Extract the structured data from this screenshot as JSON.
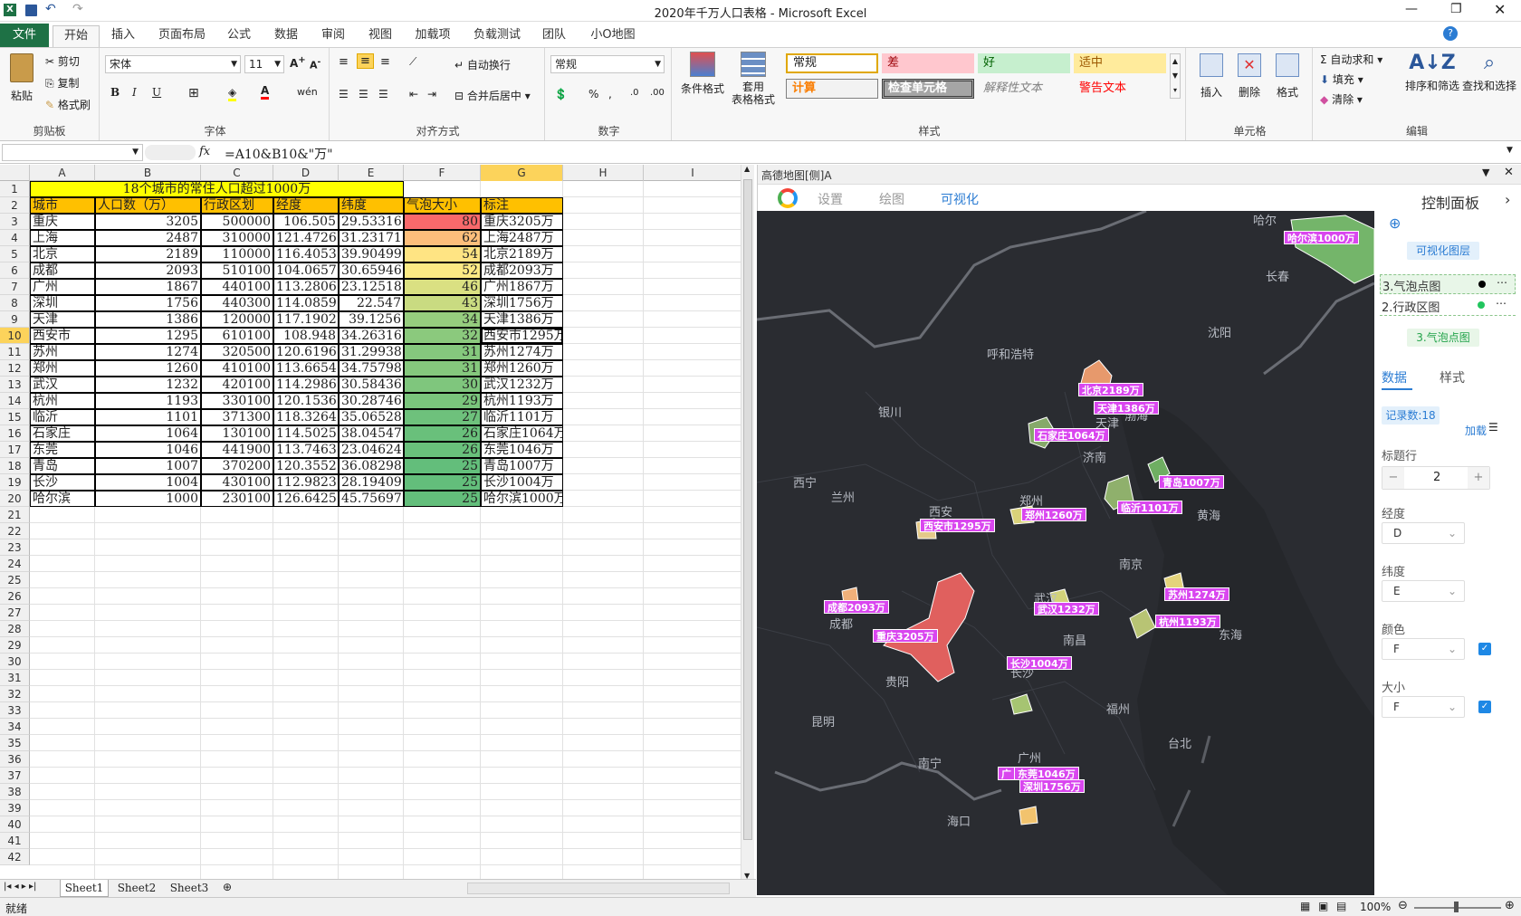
{
  "window": {
    "title": "2020年千万人口表格 - Microsoft Excel"
  },
  "tabs": [
    "文件",
    "开始",
    "插入",
    "页面布局",
    "公式",
    "数据",
    "审阅",
    "视图",
    "加载项",
    "负载测试",
    "团队",
    "小O地图"
  ],
  "ribbon": {
    "clipboard": {
      "paste": "粘贴",
      "cut": "剪切",
      "copy": "复制",
      "format_painter": "格式刷",
      "label": "剪贴板"
    },
    "font": {
      "name": "宋体",
      "size": "11",
      "label": "字体"
    },
    "align": {
      "wrap": "自动换行",
      "merge": "合并后居中",
      "label": "对齐方式"
    },
    "number": {
      "format": "常规",
      "label": "数字"
    },
    "styles": {
      "cond": "条件格式",
      "table": "套用\n表格格式",
      "normal": "常规",
      "bad": "差",
      "good": "好",
      "neutral": "适中",
      "calc": "计算",
      "check": "检查单元格",
      "explain": "解释性文本",
      "warn": "警告文本",
      "label": "样式"
    },
    "cells": {
      "insert": "插入",
      "delete": "删除",
      "format": "格式",
      "label": "单元格"
    },
    "edit": {
      "autosum": "自动求和",
      "fill": "填充",
      "clear": "清除",
      "sort": "排序和筛选",
      "find": "查找和选择",
      "label": "编辑"
    }
  },
  "formula": {
    "fx": "fx",
    "content": "=A10&B10&\"万\""
  },
  "sheet": {
    "columns": [
      "A",
      "B",
      "C",
      "D",
      "E",
      "F",
      "G",
      "H",
      "I"
    ],
    "title": "18个城市的常住人口超过1000万",
    "headers": [
      "城市",
      "人口数（万）",
      "行政区划",
      "经度",
      "纬度",
      "气泡大小",
      "标注"
    ],
    "rows": [
      [
        "重庆",
        "3205",
        "500000",
        "106.505",
        "29.53316",
        "80",
        "重庆3205万"
      ],
      [
        "上海",
        "2487",
        "310000",
        "121.4726",
        "31.23171",
        "62",
        "上海2487万"
      ],
      [
        "北京",
        "2189",
        "110000",
        "116.4053",
        "39.90499",
        "54",
        "北京2189万"
      ],
      [
        "成都",
        "2093",
        "510100",
        "104.0657",
        "30.65946",
        "52",
        "成都2093万"
      ],
      [
        "广州",
        "1867",
        "440100",
        "113.2806",
        "23.12518",
        "46",
        "广州1867万"
      ],
      [
        "深圳",
        "1756",
        "440300",
        "114.0859",
        "22.547",
        "43",
        "深圳1756万"
      ],
      [
        "天津",
        "1386",
        "120000",
        "117.1902",
        "39.1256",
        "34",
        "天津1386万"
      ],
      [
        "西安市",
        "1295",
        "610100",
        "108.948",
        "34.26316",
        "32",
        "西安市1295万"
      ],
      [
        "苏州",
        "1274",
        "320500",
        "120.6196",
        "31.29938",
        "31",
        "苏州1274万"
      ],
      [
        "郑州",
        "1260",
        "410100",
        "113.6654",
        "34.75798",
        "31",
        "郑州1260万"
      ],
      [
        "武汉",
        "1232",
        "420100",
        "114.2986",
        "30.58436",
        "30",
        "武汉1232万"
      ],
      [
        "杭州",
        "1193",
        "330100",
        "120.1536",
        "30.28746",
        "29",
        "杭州1193万"
      ],
      [
        "临沂",
        "1101",
        "371300",
        "118.3264",
        "35.06528",
        "27",
        "临沂1101万"
      ],
      [
        "石家庄",
        "1064",
        "130100",
        "114.5025",
        "38.04547",
        "26",
        "石家庄1064万"
      ],
      [
        "东莞",
        "1046",
        "441900",
        "113.7463",
        "23.04624",
        "26",
        "东莞1046万"
      ],
      [
        "青岛",
        "1007",
        "370200",
        "120.3552",
        "36.08298",
        "25",
        "青岛1007万"
      ],
      [
        "长沙",
        "1004",
        "430100",
        "112.9823",
        "28.19409",
        "25",
        "长沙1004万"
      ],
      [
        "哈尔滨",
        "1000",
        "230100",
        "126.6425",
        "45.75697",
        "25",
        "哈尔滨1000万"
      ]
    ],
    "row_numbers": [
      "1",
      "2",
      "3",
      "4",
      "5",
      "6",
      "7",
      "8",
      "9",
      "10",
      "11",
      "12",
      "13",
      "14",
      "15",
      "16",
      "17",
      "18",
      "19",
      "20",
      "21",
      "22",
      "23",
      "24",
      "25",
      "26",
      "27",
      "28",
      "29",
      "30",
      "31",
      "32",
      "33",
      "34",
      "35",
      "36",
      "37",
      "38",
      "39",
      "40",
      "41",
      "42"
    ],
    "sheet_tabs": [
      "Sheet1",
      "Sheet2",
      "Sheet3"
    ]
  },
  "panel": {
    "title": "高德地图[侧]A",
    "tabs": [
      "设置",
      "绘图",
      "可视化"
    ],
    "control_title": "控制面板",
    "layers_btn": "可视化图层",
    "layers": [
      "3.气泡点图",
      "2.行政区图"
    ],
    "active_layer": "3.气泡点图",
    "subtabs": [
      "数据",
      "样式"
    ],
    "records": "记录数:18",
    "load": "加载",
    "title_row_label": "标题行",
    "title_row_value": "2",
    "lng_label": "经度",
    "lng_value": "D",
    "lat_label": "纬度",
    "lat_value": "E",
    "color_label": "颜色",
    "color_value": "F",
    "size_label": "大小",
    "size_value": "F"
  },
  "map": {
    "places": [
      "哈尔",
      "长春",
      "沈阳",
      "呼和浩特",
      "银川",
      "兰州",
      "西宁",
      "西安",
      "郑州",
      "济南",
      "渤海",
      "黄海",
      "南京",
      "武汉",
      "南昌",
      "东海",
      "长沙",
      "贵阳",
      "福州",
      "台北",
      "昆明",
      "南宁",
      "广州",
      "海口",
      "成都",
      "天津"
    ],
    "bubbles": [
      "哈尔滨1000万",
      "北京2189万",
      "天津1386万",
      "石家庄1064万",
      "青岛1007万",
      "临沂1101万",
      "郑州1260万",
      "西安市1295万",
      "苏州1274万",
      "成都2093万",
      "武汉1232万",
      "杭州1193万",
      "重庆3205万",
      "长沙1004万",
      "东莞1046万",
      "深圳1756万",
      "广"
    ]
  },
  "status": {
    "ready": "就绪",
    "zoom": "100%"
  }
}
